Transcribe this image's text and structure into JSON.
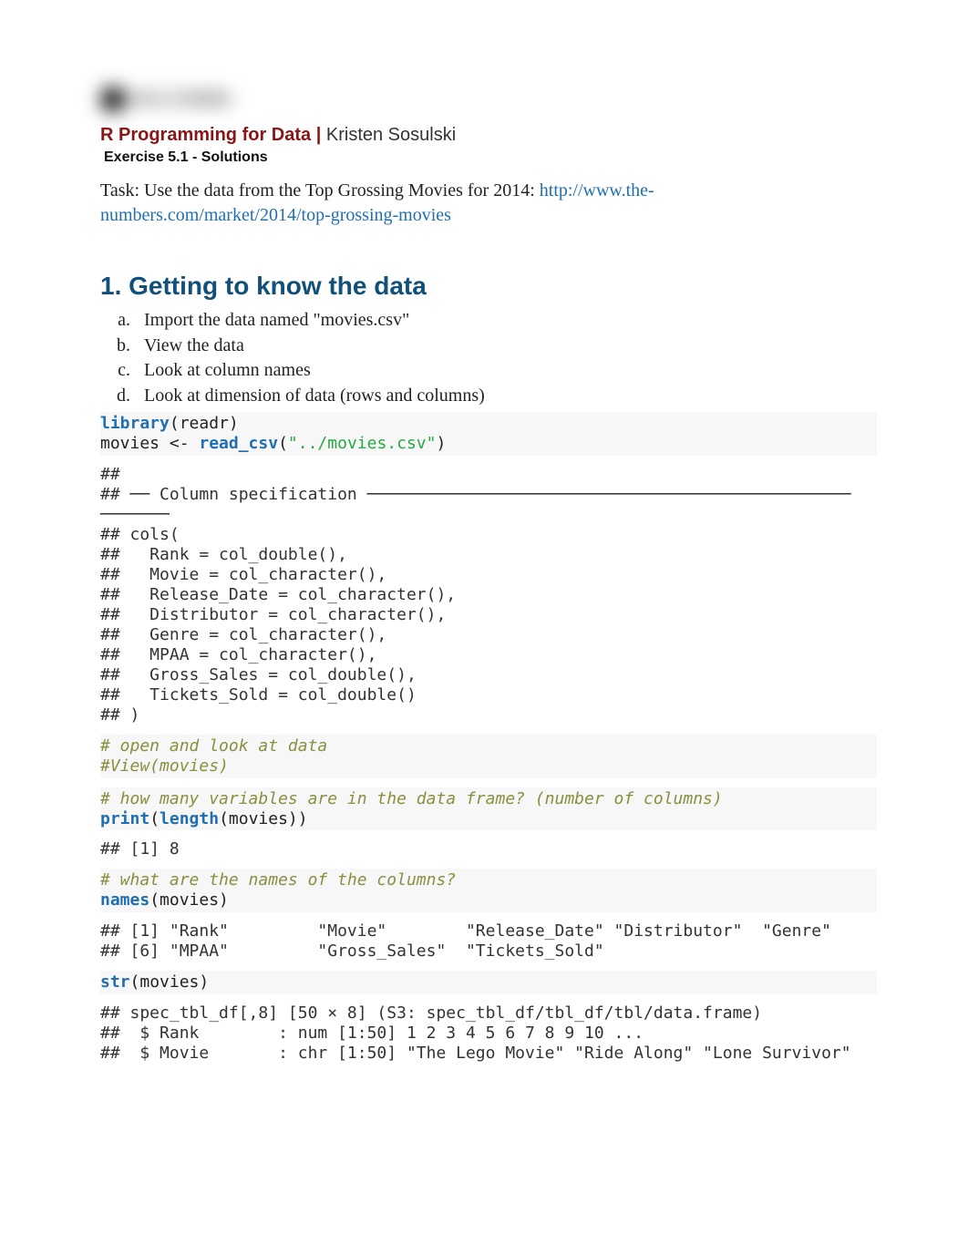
{
  "logo": {
    "text": "NYU STERN"
  },
  "header": {
    "course_bold": "R Programming for Data",
    "sep": " | ",
    "author": "Kristen Sosulski",
    "exercise": "Exercise 5.1 - Solutions"
  },
  "task": {
    "prefix": "Task: Use the data from the Top Grossing Movies for 2014: ",
    "link_text": "http://www.the-numbers.com/market/2014/top-grossing-movies",
    "link_href": "http://www.the-numbers.com/market/2014/top-grossing-movies"
  },
  "section1": {
    "title": "1. Getting to know the data",
    "items": [
      "Import the data named \"movies.csv\"",
      "View the data",
      "Look at column names",
      "Look at dimension of data (rows and columns)"
    ]
  },
  "code1": {
    "library_kw": "library",
    "library_arg": "(readr)",
    "movies_lhs": "movies <- ",
    "read_fn": "read_csv",
    "read_arg_open": "(",
    "read_str": "\"../movies.csv\"",
    "read_arg_close": ")"
  },
  "out1": "## \n## ── Column specification ─────────────────────────────────────────────────\n───────\n## cols(\n##   Rank = col_double(),\n##   Movie = col_character(),\n##   Release_Date = col_character(),\n##   Distributor = col_character(),\n##   Genre = col_character(),\n##   MPAA = col_character(),\n##   Gross_Sales = col_double(),\n##   Tickets_Sold = col_double()\n## )",
  "code2": {
    "c1": "# open and look at data",
    "c2": "#View(movies)"
  },
  "code3": {
    "c1": "# how many variables are in the data frame? (number of columns)",
    "print_kw": "print",
    "open": "(",
    "length_kw": "length",
    "inner": "(movies))"
  },
  "out3": "## [1] 8",
  "code4": {
    "c1": "# what are the names of the columns?",
    "names_kw": "names",
    "arg": "(movies)"
  },
  "out4": "## [1] \"Rank\"         \"Movie\"        \"Release_Date\" \"Distributor\"  \"Genre\"       \n## [6] \"MPAA\"         \"Gross_Sales\"  \"Tickets_Sold\"",
  "code5": {
    "str_kw": "str",
    "arg": "(movies)"
  },
  "out5": "## spec_tbl_df[,8] [50 × 8] (S3: spec_tbl_df/tbl_df/tbl/data.frame)\n##  $ Rank        : num [1:50] 1 2 3 4 5 6 7 8 9 10 ...\n##  $ Movie       : chr [1:50] \"The Lego Movie\" \"Ride Along\" \"Lone Survivor\""
}
